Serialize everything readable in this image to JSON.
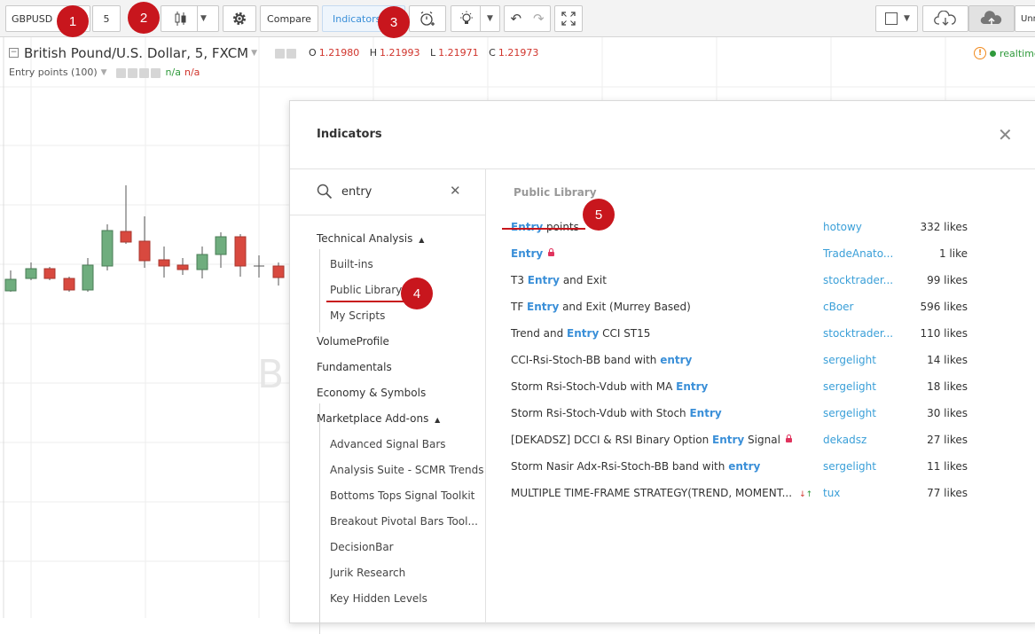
{
  "toolbar": {
    "symbol": "GBPUSD",
    "interval": "5",
    "compare_label": "Compare",
    "indicators_label": "Indicators",
    "right_label": "Unm"
  },
  "badges": [
    "1",
    "2",
    "3",
    "4",
    "5"
  ],
  "chart": {
    "title": "British Pound/U.S. Dollar, 5, FXCM",
    "ohlc": [
      {
        "k": "O",
        "v": "1.21980"
      },
      {
        "k": "H",
        "v": "1.21993"
      },
      {
        "k": "L",
        "v": "1.21971"
      },
      {
        "k": "C",
        "v": "1.21973"
      }
    ],
    "indicator_label": "Entry points (100)",
    "indicator_value_green": "n/a",
    "indicator_value_red": "n/a",
    "watermark": "B",
    "status": "realtime",
    "up_color": "#6fad7e",
    "down_color": "#d8493f"
  },
  "dialog": {
    "title": "Indicators",
    "search_value": "entry",
    "categories": [
      {
        "label": "Technical Analysis",
        "caret": "▲"
      },
      {
        "label": "Built-ins"
      },
      {
        "label": "Public Library"
      },
      {
        "label": "My Scripts"
      },
      {
        "label": "VolumeProfile"
      },
      {
        "label": "Fundamentals"
      },
      {
        "label": "Economy & Symbols"
      },
      {
        "label": "Marketplace Add-ons",
        "caret": "▲"
      },
      {
        "label": "Advanced Signal Bars"
      },
      {
        "label": "Analysis Suite - SCMR Trends"
      },
      {
        "label": "Bottoms Tops Signal Toolkit"
      },
      {
        "label": "Breakout Pivotal Bars Tool..."
      },
      {
        "label": "DecisionBar"
      },
      {
        "label": "Jurik Research"
      },
      {
        "label": "Key Hidden Levels"
      }
    ],
    "section_title": "Public Library",
    "results": [
      {
        "pre": "",
        "hl": "Entry",
        "post": " points",
        "author": "hotowy",
        "likes": "332 likes"
      },
      {
        "pre": "",
        "hl": "Entry",
        "post": "",
        "lock": true,
        "author": "TradeAnato...",
        "likes": "1 like"
      },
      {
        "pre": "T3 ",
        "hl": "Entry",
        "post": " and Exit",
        "author": "stocktrader...",
        "likes": "99 likes"
      },
      {
        "pre": "TF ",
        "hl": "Entry",
        "post": " and Exit (Murrey Based)",
        "author": "cBoer",
        "likes": "596 likes"
      },
      {
        "pre": "Trend and ",
        "hl": "Entry",
        "post": " CCI ST15",
        "author": "stocktrader...",
        "likes": "110 likes"
      },
      {
        "pre": "CCI-Rsi-Stoch-BB band with ",
        "hl": "entry",
        "post": "",
        "author": "sergelight",
        "likes": "14 likes"
      },
      {
        "pre": "Storm Rsi-Stoch-Vdub with MA ",
        "hl": "Entry",
        "post": "",
        "author": "sergelight",
        "likes": "18 likes"
      },
      {
        "pre": "Storm Rsi-Stoch-Vdub with Stoch ",
        "hl": "Entry",
        "post": "",
        "author": "sergelight",
        "likes": "30 likes"
      },
      {
        "pre": "[DEKADSZ] DCCI & RSI Binary Option ",
        "hl": "Entry",
        "post": " Signal",
        "lock": true,
        "author": "dekadsz",
        "likes": "27 likes"
      },
      {
        "pre": "Storm Nasir Adx-Rsi-Stoch-BB band with ",
        "hl": "entry",
        "post": "",
        "author": "sergelight",
        "likes": "11 likes"
      },
      {
        "pre": "MULTIPLE TIME-FRAME STRATEGY(TREND, MOMENT...",
        "hl": "",
        "post": "",
        "arrows": true,
        "author": "tux",
        "likes": "77 likes"
      }
    ]
  }
}
